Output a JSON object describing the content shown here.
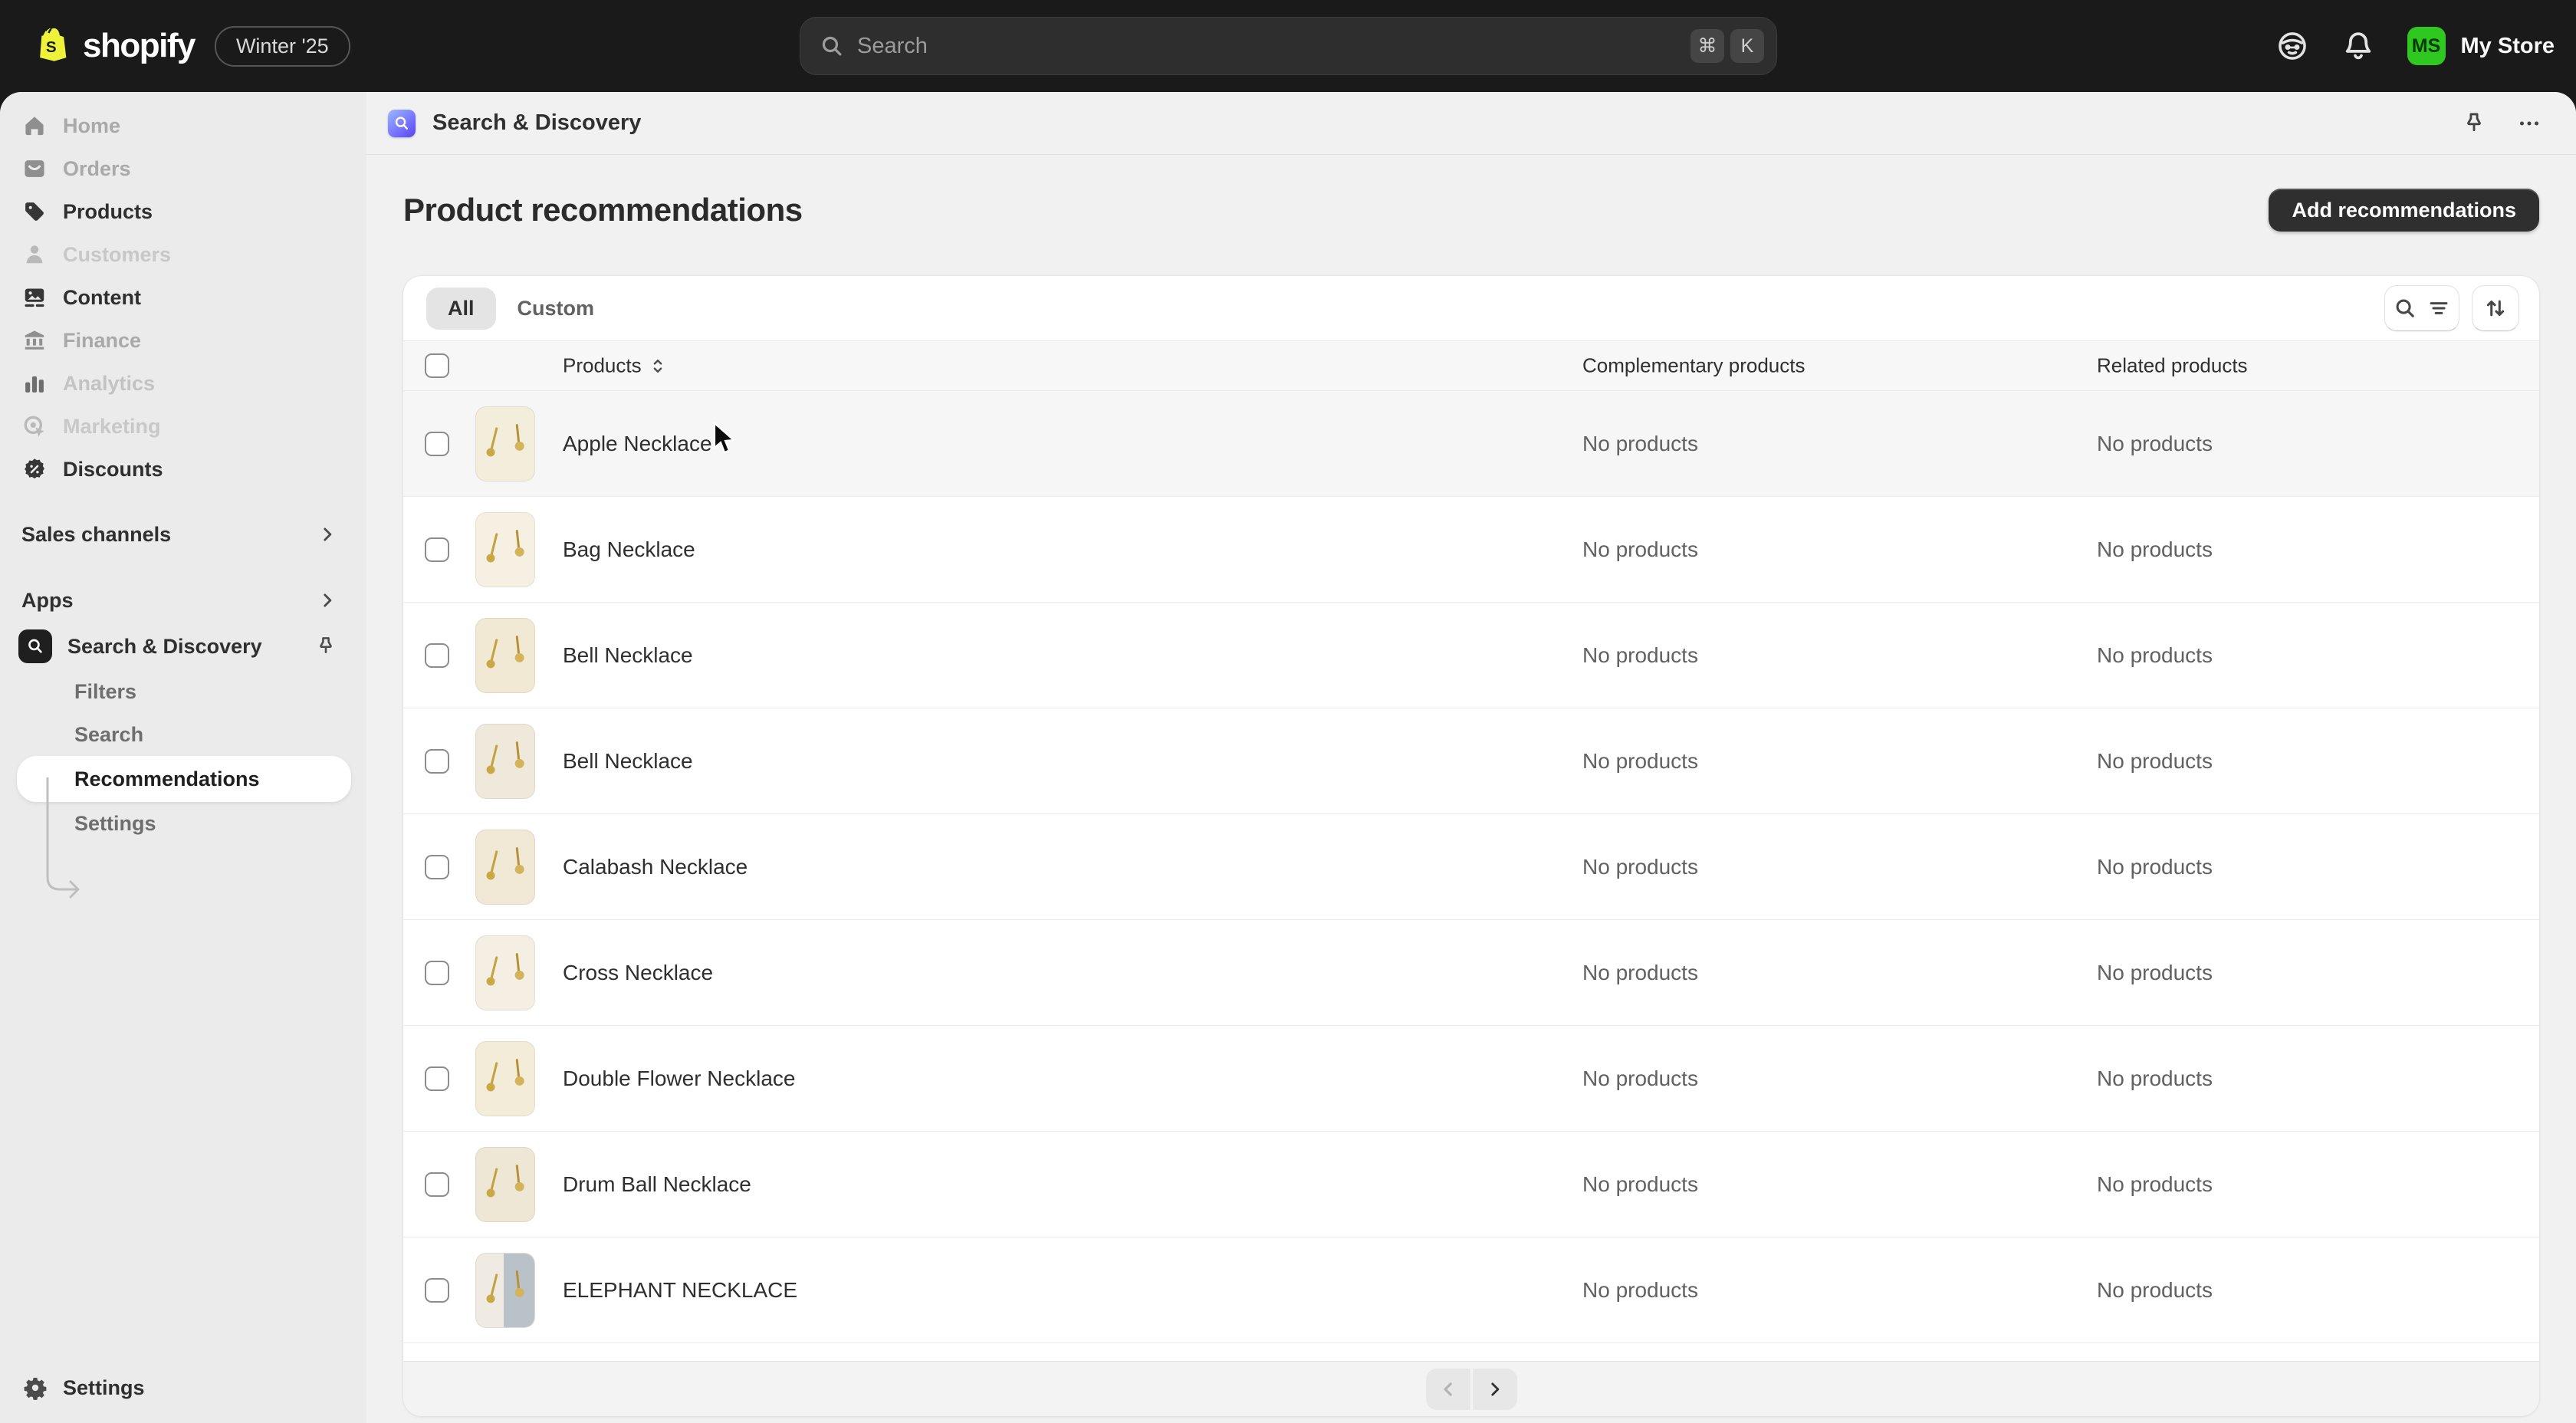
{
  "topbar": {
    "logo_text": "shopify",
    "edition_badge": "Winter '25",
    "search_placeholder": "Search",
    "kbd_cmd": "⌘",
    "kbd_k": "K",
    "icons": [
      "search-icon",
      "assistant-icon",
      "bell-icon"
    ],
    "store_initials": "MS",
    "store_name": "My Store",
    "avatar_color": "#2fc821"
  },
  "sidebar": {
    "items": [
      {
        "label": "Home",
        "icon": "home",
        "state": "dim"
      },
      {
        "label": "Orders",
        "icon": "orders",
        "state": "dim"
      },
      {
        "label": "Products",
        "icon": "products",
        "state": "dark"
      },
      {
        "label": "Customers",
        "icon": "customers",
        "state": "faint"
      },
      {
        "label": "Content",
        "icon": "content",
        "state": "dark"
      },
      {
        "label": "Finance",
        "icon": "finance",
        "state": "dim"
      },
      {
        "label": "Analytics",
        "icon": "analytics",
        "state": "mixed"
      },
      {
        "label": "Marketing",
        "icon": "marketing",
        "state": "faint"
      },
      {
        "label": "Discounts",
        "icon": "discounts",
        "state": "dark"
      }
    ],
    "sales_channels_label": "Sales channels",
    "apps_label": "Apps",
    "app": {
      "name": "Search & Discovery",
      "icon": "magnifier-app-icon",
      "pinned_icon": "pin-icon",
      "children": [
        "Filters",
        "Search",
        "Recommendations",
        "Settings"
      ],
      "active_child": "Recommendations"
    },
    "settings_label": "Settings"
  },
  "app_header": {
    "title": "Search & Discovery",
    "icons": [
      "pin-icon",
      "ellipsis-icon"
    ]
  },
  "page": {
    "title": "Product recommendations",
    "add_button_label": "Add recommendations"
  },
  "tabs": [
    {
      "label": "All",
      "active": true
    },
    {
      "label": "Custom",
      "active": false
    }
  ],
  "toolbar_icons": [
    "search-icon",
    "filter-icon",
    "sort-icon"
  ],
  "table": {
    "columns": [
      "Products",
      "Complementary products",
      "Related products"
    ],
    "empty_text": "No products",
    "rows": [
      {
        "name": "Apple Necklace",
        "thumb_bg": "#f3eddc",
        "hovered": true
      },
      {
        "name": "Bag Necklace",
        "thumb_bg": "#f6f0e3"
      },
      {
        "name": "Bell Necklace",
        "thumb_bg": "#f1e9d4"
      },
      {
        "name": "Bell Necklace",
        "thumb_bg": "#efe9dc"
      },
      {
        "name": "Calabash Necklace",
        "thumb_bg": "#f1e8d6"
      },
      {
        "name": "Cross Necklace",
        "thumb_bg": "#f4efe2"
      },
      {
        "name": "Double Flower Necklace",
        "thumb_bg": "#f3ecd9"
      },
      {
        "name": "Drum Ball Necklace",
        "thumb_bg": "#efe7d5"
      },
      {
        "name": "ELEPHANT NECKLACE",
        "thumb_bg": "#f0ebe2",
        "split": true
      }
    ]
  },
  "pagination": {
    "prev_enabled": false,
    "next_enabled": true
  }
}
